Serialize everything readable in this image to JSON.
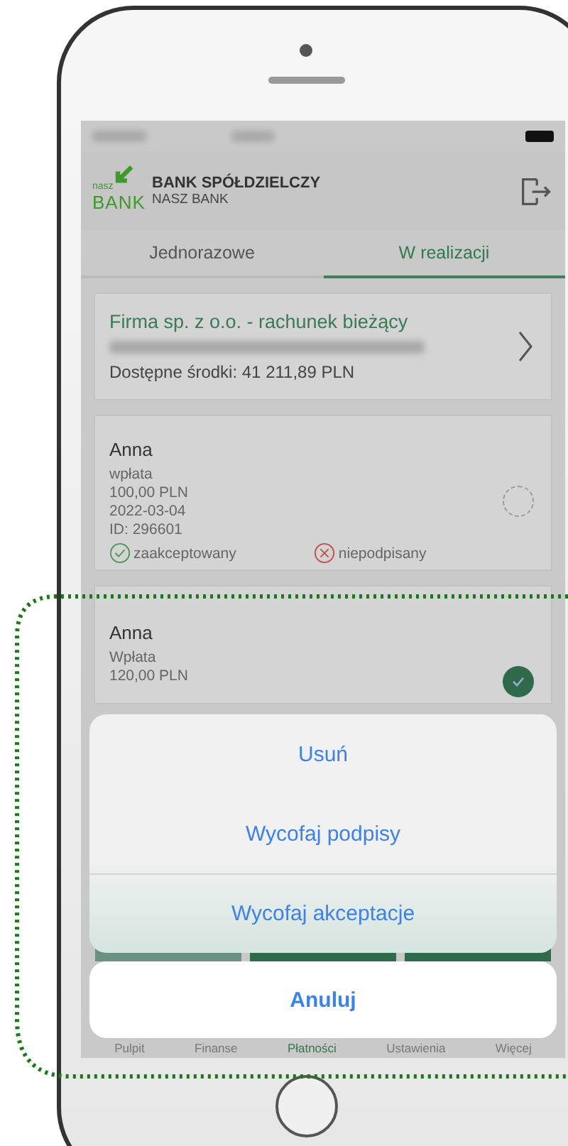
{
  "header": {
    "logo_small": "nasz",
    "logo_big": "BANK",
    "bank_name": "BANK SPÓŁDZIELCZY",
    "bank_sub": "NASZ BANK"
  },
  "tabs": [
    {
      "label": "Jednorazowe",
      "selected": false
    },
    {
      "label": "W realizacji",
      "selected": true
    }
  ],
  "account": {
    "name": "Firma sp. z o.o. - rachunek bieżący",
    "balance": "Dostępne środki: 41 211,89 PLN"
  },
  "transactions": [
    {
      "name": "Anna",
      "type": "wpłata",
      "amount": "100,00 PLN",
      "date": "2022-03-04",
      "id": "ID: 296601",
      "selected": false,
      "statuses": [
        {
          "kind": "ok",
          "label": "zaakceptowany"
        },
        {
          "kind": "error",
          "label": "niepodpisany"
        }
      ]
    },
    {
      "name": "Anna",
      "type": "Wpłata",
      "amount": "120,00 PLN",
      "selected": true
    }
  ],
  "action_sheet": {
    "options": [
      "Usuń",
      "Wycofaj podpisy",
      "Wycofaj akceptacje"
    ],
    "cancel": "Anuluj"
  },
  "bottom_nav": [
    {
      "label": "Pulpit",
      "selected": false
    },
    {
      "label": "Finanse",
      "selected": false
    },
    {
      "label": "Płatności",
      "selected": true
    },
    {
      "label": "Ustawienia",
      "selected": false
    },
    {
      "label": "Więcej",
      "selected": false
    }
  ]
}
